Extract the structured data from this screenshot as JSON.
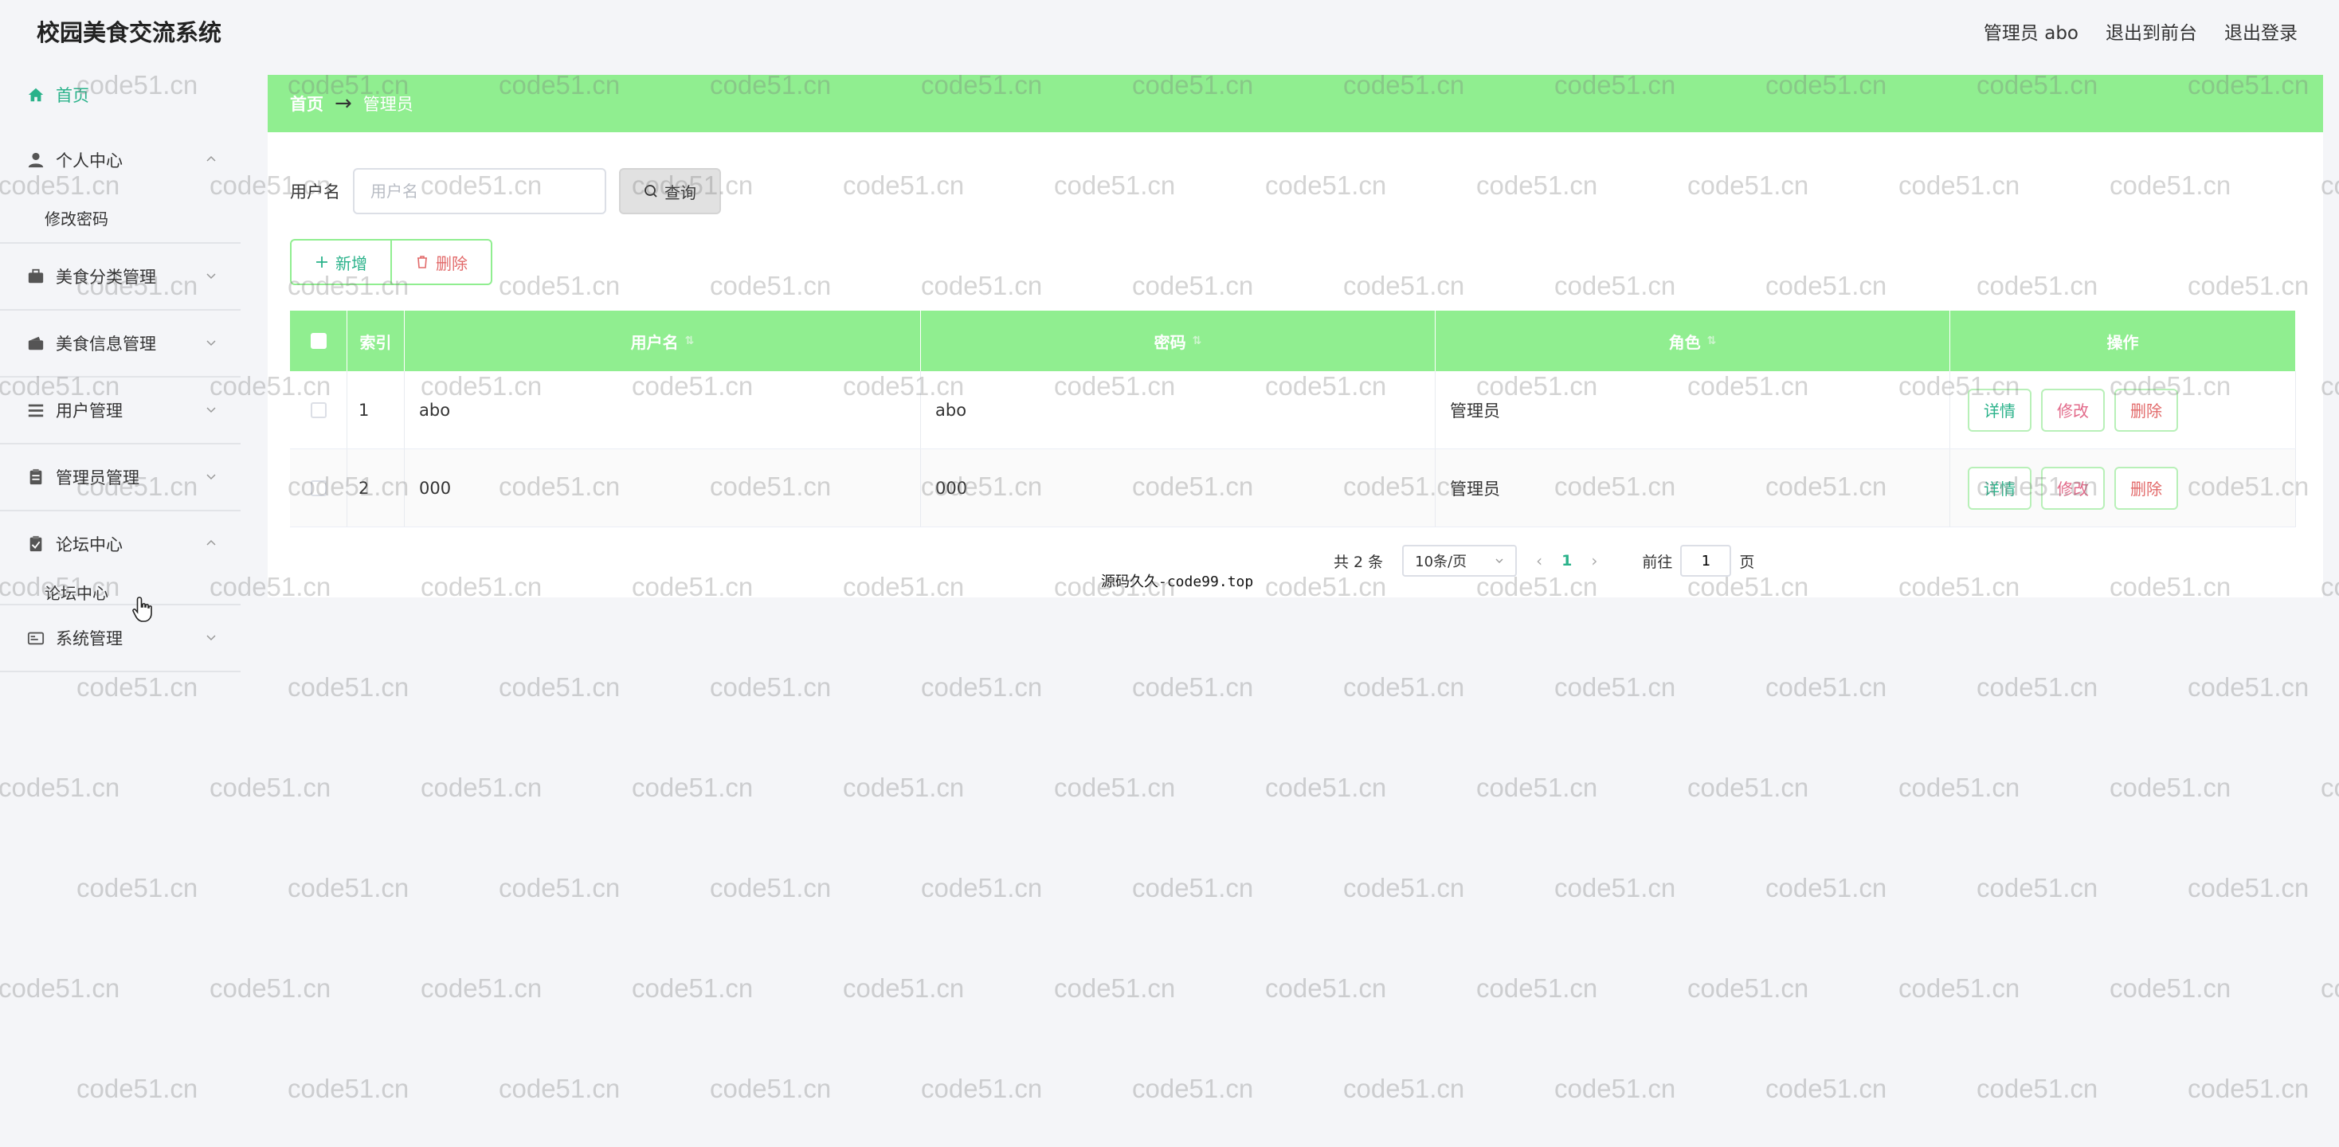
{
  "app": {
    "title": "校园美食交流系统"
  },
  "header": {
    "user_label": "管理员 abo",
    "front_label": "退出到前台",
    "logout_label": "退出登录"
  },
  "sidebar": {
    "items": [
      {
        "label": "首页",
        "icon": "home-icon",
        "active": true
      },
      {
        "label": "个人中心",
        "icon": "user-icon",
        "expanded": true,
        "sub": [
          "修改密码"
        ]
      },
      {
        "label": "美食分类管理",
        "icon": "briefcase-icon"
      },
      {
        "label": "美食信息管理",
        "icon": "wallet-icon"
      },
      {
        "label": "用户管理",
        "icon": "list-icon"
      },
      {
        "label": "管理员管理",
        "icon": "clipboard-icon"
      },
      {
        "label": "论坛中心",
        "icon": "clipboard-check-icon",
        "expanded": true,
        "sub": [
          "论坛中心"
        ]
      },
      {
        "label": "系统管理",
        "icon": "card-icon"
      }
    ]
  },
  "breadcrumb": {
    "home": "首页",
    "separator": "→",
    "current": "管理员"
  },
  "search": {
    "label": "用户名",
    "placeholder": "用户名",
    "value": "",
    "button": "查询"
  },
  "actions": {
    "add": "新增",
    "delete": "删除"
  },
  "table": {
    "headers": {
      "index": "索引",
      "username": "用户名",
      "password": "密码",
      "role": "角色",
      "ops": "操作"
    },
    "rows": [
      {
        "index": "1",
        "username": "abo",
        "password": "abo",
        "role": "管理员"
      },
      {
        "index": "2",
        "username": "000",
        "password": "000",
        "role": "管理员"
      }
    ],
    "ops": {
      "detail": "详情",
      "edit": "修改",
      "delete": "删除"
    }
  },
  "pagination": {
    "total": "共 2 条",
    "page_size": "10条/页",
    "current_page": "1",
    "goto_label": "前往",
    "goto_value": "1",
    "page_unit": "页"
  },
  "footer_note": "源码久久-code99.top",
  "watermark": "code51.cn",
  "colors": {
    "accent_green": "#90ee90",
    "active_text": "#2ab28a",
    "danger": "#e26a6a"
  }
}
